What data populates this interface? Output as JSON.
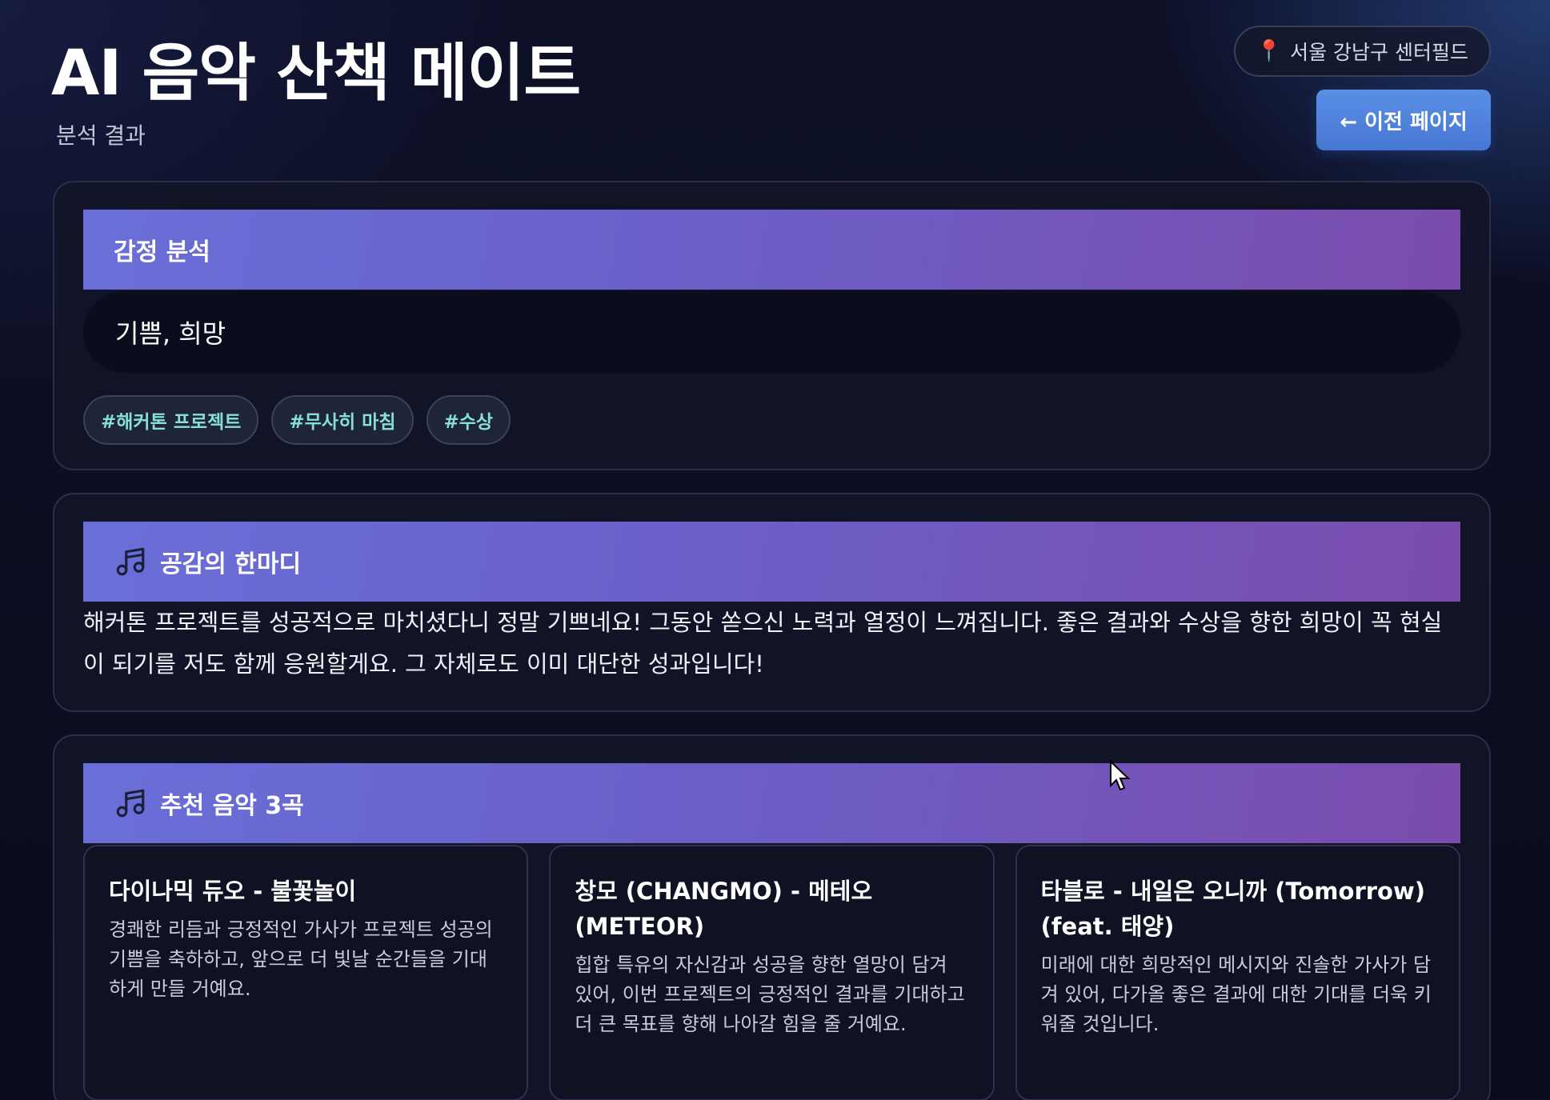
{
  "header": {
    "title": "AI 음악 산책 메이트",
    "subtitle": "분석 결과",
    "location": "서울 강남구 센터필드",
    "back_button": "← 이전 페이지"
  },
  "emotion_section": {
    "title": "감정 분석",
    "emotions": "기쁨, 희망",
    "tags": [
      "#해커톤 프로젝트",
      "#무사히 마침",
      "#수상"
    ]
  },
  "empathy_section": {
    "title": "공감의 한마디",
    "text": "해커톤 프로젝트를 성공적으로 마치셨다니 정말 기쁘네요! 그동안 쏟으신 노력과 열정이 느껴집니다. 좋은 결과와 수상을 향한 희망이 꼭 현실이 되기를 저도 함께 응원할게요. 그 자체로도 이미 대단한 성과입니다!"
  },
  "music_section": {
    "title": "추천 음악 3곡",
    "songs": [
      {
        "title": "다이나믹 듀오 - 불꽃놀이",
        "description": "경쾌한 리듬과 긍정적인 가사가 프로젝트 성공의 기쁨을 축하하고, 앞으로 더 빛날 순간들을 기대하게 만들 거예요."
      },
      {
        "title": "창모 (CHANGMO) - 메테오 (METEOR)",
        "description": "힙합 특유의 자신감과 성공을 향한 열망이 담겨 있어, 이번 프로젝트의 긍정적인 결과를 기대하고 더 큰 목표를 향해 나아갈 힘을 줄 거예요."
      },
      {
        "title": "타블로 - 내일은 오니까 (Tomorrow) (feat. 태양)",
        "description": "미래에 대한 희망적인 메시지와 진솔한 가사가 담겨 있어, 다가올 좋은 결과에 대한 기대를 더욱 키워줄 것입니다."
      }
    ]
  },
  "colors": {
    "background": "#0b0d1f",
    "banner_start": "#6a6fd8",
    "banner_end": "#7a4cab",
    "button": "#4f83dc",
    "tag_text": "#86dfd8"
  },
  "icons": [
    "pin-icon",
    "music-note-icon",
    "cursor-icon"
  ]
}
